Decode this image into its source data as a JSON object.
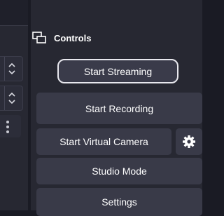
{
  "controls": {
    "title": "Controls",
    "start_streaming": "Start Streaming",
    "start_recording": "Start Recording",
    "start_virtual_camera": "Start Virtual Camera",
    "studio_mode": "Studio Mode",
    "settings": "Settings"
  },
  "icons": {
    "dock": "dock-windows-icon",
    "gear": "gear-icon",
    "spinner": "chevron-up-down-icon",
    "handle": "vertical-dots-icon"
  }
}
